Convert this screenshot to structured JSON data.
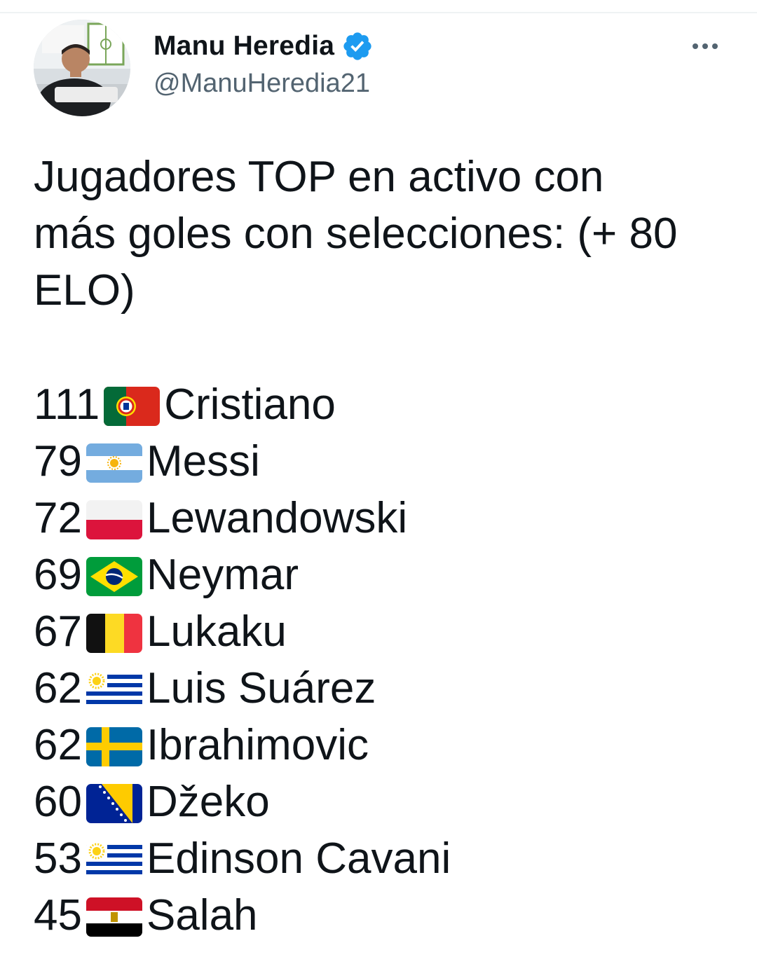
{
  "tweet": {
    "author": {
      "display_name": "Manu Heredia",
      "handle": "@ManuHeredia21",
      "verified": true,
      "avatar_icon": "avatar-photo"
    },
    "more_icon": "more-horizontal-icon",
    "text_lines": [
      "Jugadores TOP en activo con",
      "más goles con selecciones: (+ 80",
      "ELO)"
    ],
    "rankings": [
      {
        "goals": "111",
        "flag": "portugal-flag-icon",
        "name": "Cristiano"
      },
      {
        "goals": "79",
        "flag": "argentina-flag-icon",
        "name": "Messi"
      },
      {
        "goals": "72",
        "flag": "poland-flag-icon",
        "name": "Lewandowski"
      },
      {
        "goals": "69",
        "flag": "brazil-flag-icon",
        "name": "Neymar"
      },
      {
        "goals": "67",
        "flag": "belgium-flag-icon",
        "name": "Lukaku"
      },
      {
        "goals": "62",
        "flag": "uruguay-flag-icon",
        "name": "Luis Suárez"
      },
      {
        "goals": "62",
        "flag": "sweden-flag-icon",
        "name": "Ibrahimovic"
      },
      {
        "goals": "60",
        "flag": "bosnia-flag-icon",
        "name": "Džeko"
      },
      {
        "goals": "53",
        "flag": "uruguay-flag-icon",
        "name": "Edinson Cavani"
      },
      {
        "goals": "45",
        "flag": "egypt-flag-icon",
        "name": "Salah"
      }
    ]
  },
  "colors": {
    "text": "#0f1419",
    "secondary_text": "#536471",
    "verified_blue": "#1d9bf0"
  }
}
